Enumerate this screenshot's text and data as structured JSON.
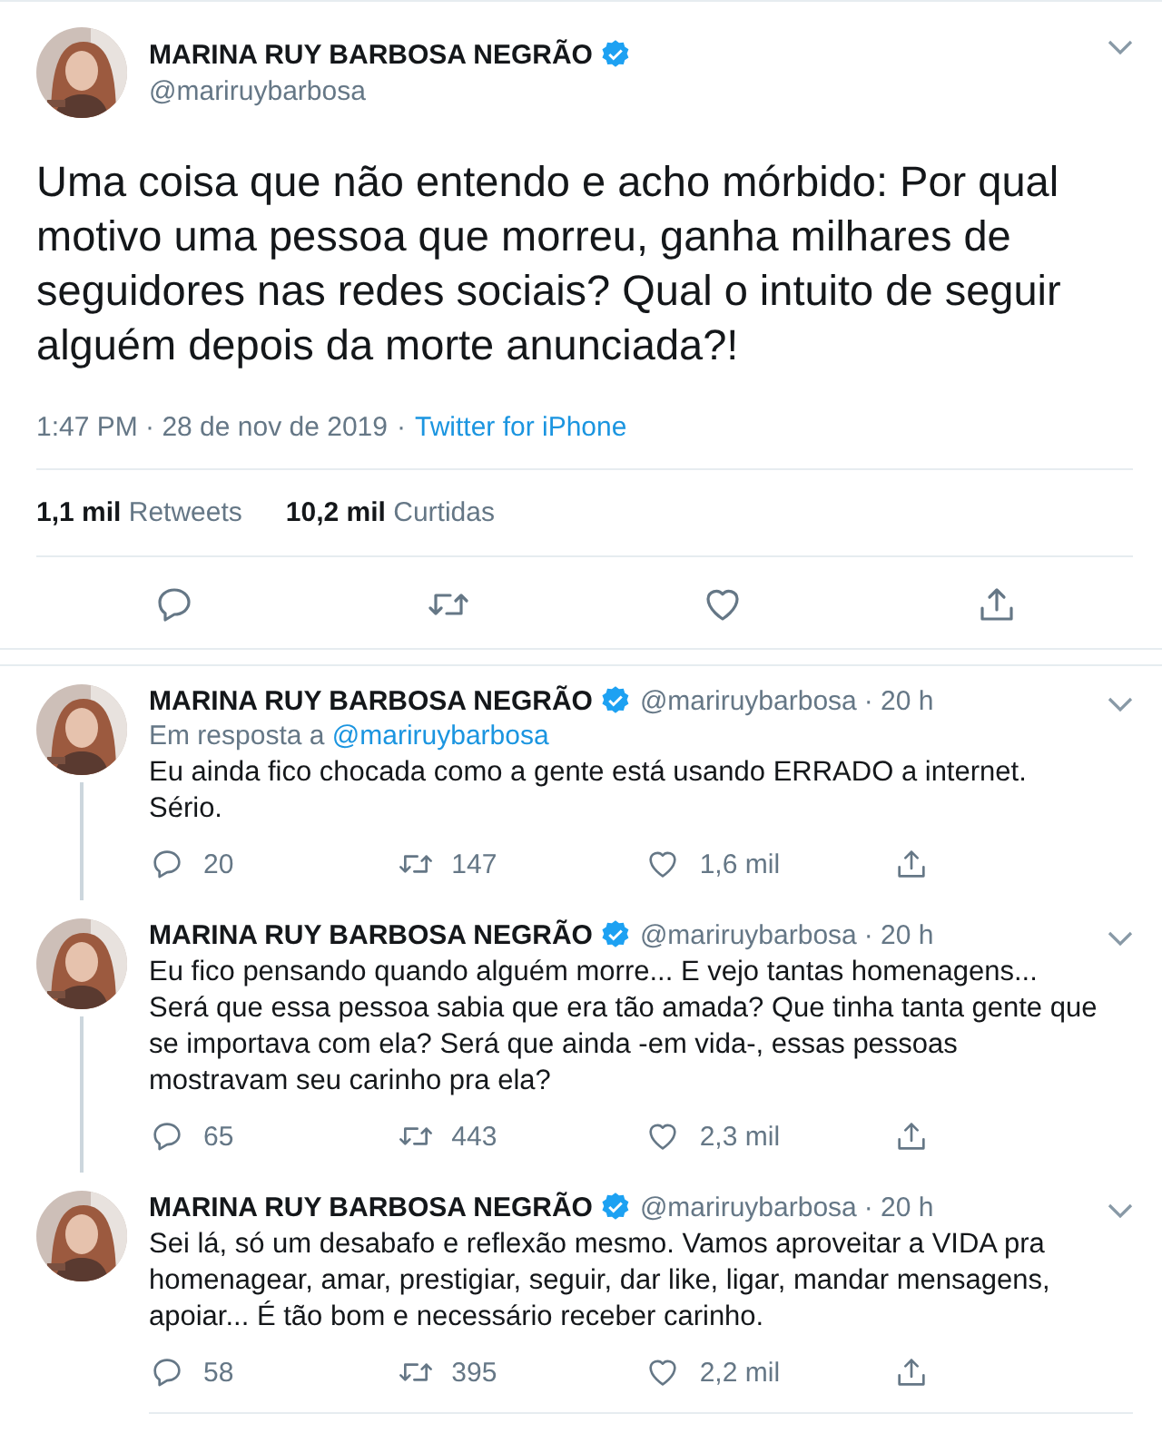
{
  "main_tweet": {
    "author": {
      "name": "MARINA RUY BARBOSA NEGRÃO",
      "verified": true,
      "handle": "@mariruybarbosa"
    },
    "text": "Uma coisa que não entendo e acho mórbido: Por qual motivo uma pessoa que morreu, ganha milhares de seguidores nas redes sociais? Qual o intuito de seguir alguém depois da morte anunciada?!",
    "time": "1:47 PM · 28 de nov de 2019",
    "separator": "·",
    "source": "Twitter for iPhone",
    "stats": [
      {
        "count": "1,1 mil",
        "label": "Retweets"
      },
      {
        "count": "10,2 mil",
        "label": "Curtidas"
      }
    ]
  },
  "replies": [
    {
      "name": "MARINA RUY BARBOSA NEGRÃO",
      "verified": true,
      "handle": "@mariruybarbosa",
      "age": "· 20 h",
      "in_reply_to": {
        "label": "Em resposta a",
        "handle": "@mariruybarbosa"
      },
      "text": "Eu ainda fico chocada como a gente está usando ERRADO a internet. Sério.",
      "replies": "20",
      "retweets": "147",
      "likes": "1,6 mil",
      "thread_continues": true
    },
    {
      "name": "MARINA RUY BARBOSA NEGRÃO",
      "verified": true,
      "handle": "@mariruybarbosa",
      "age": "· 20 h",
      "text": "Eu fico pensando quando alguém morre... E vejo tantas homenagens... Será que essa pessoa sabia que era tão amada? Que tinha tanta gente que se importava com ela? Será que ainda -em vida-, essas pessoas mostravam seu carinho pra ela?",
      "replies": "65",
      "retweets": "443",
      "likes": "2,3 mil",
      "thread_continues": true
    },
    {
      "name": "MARINA RUY BARBOSA NEGRÃO",
      "verified": true,
      "handle": "@mariruybarbosa",
      "age": "· 20 h",
      "text": "Sei lá, só um desabafo e reflexão mesmo. Vamos aproveitar a VIDA pra homenagear, amar, prestigiar, seguir, dar like, ligar, mandar mensagens, apoiar... É tão bom e necessário receber carinho.",
      "replies": "58",
      "retweets": "395",
      "likes": "2,2 mil",
      "thread_continues": false
    }
  ]
}
